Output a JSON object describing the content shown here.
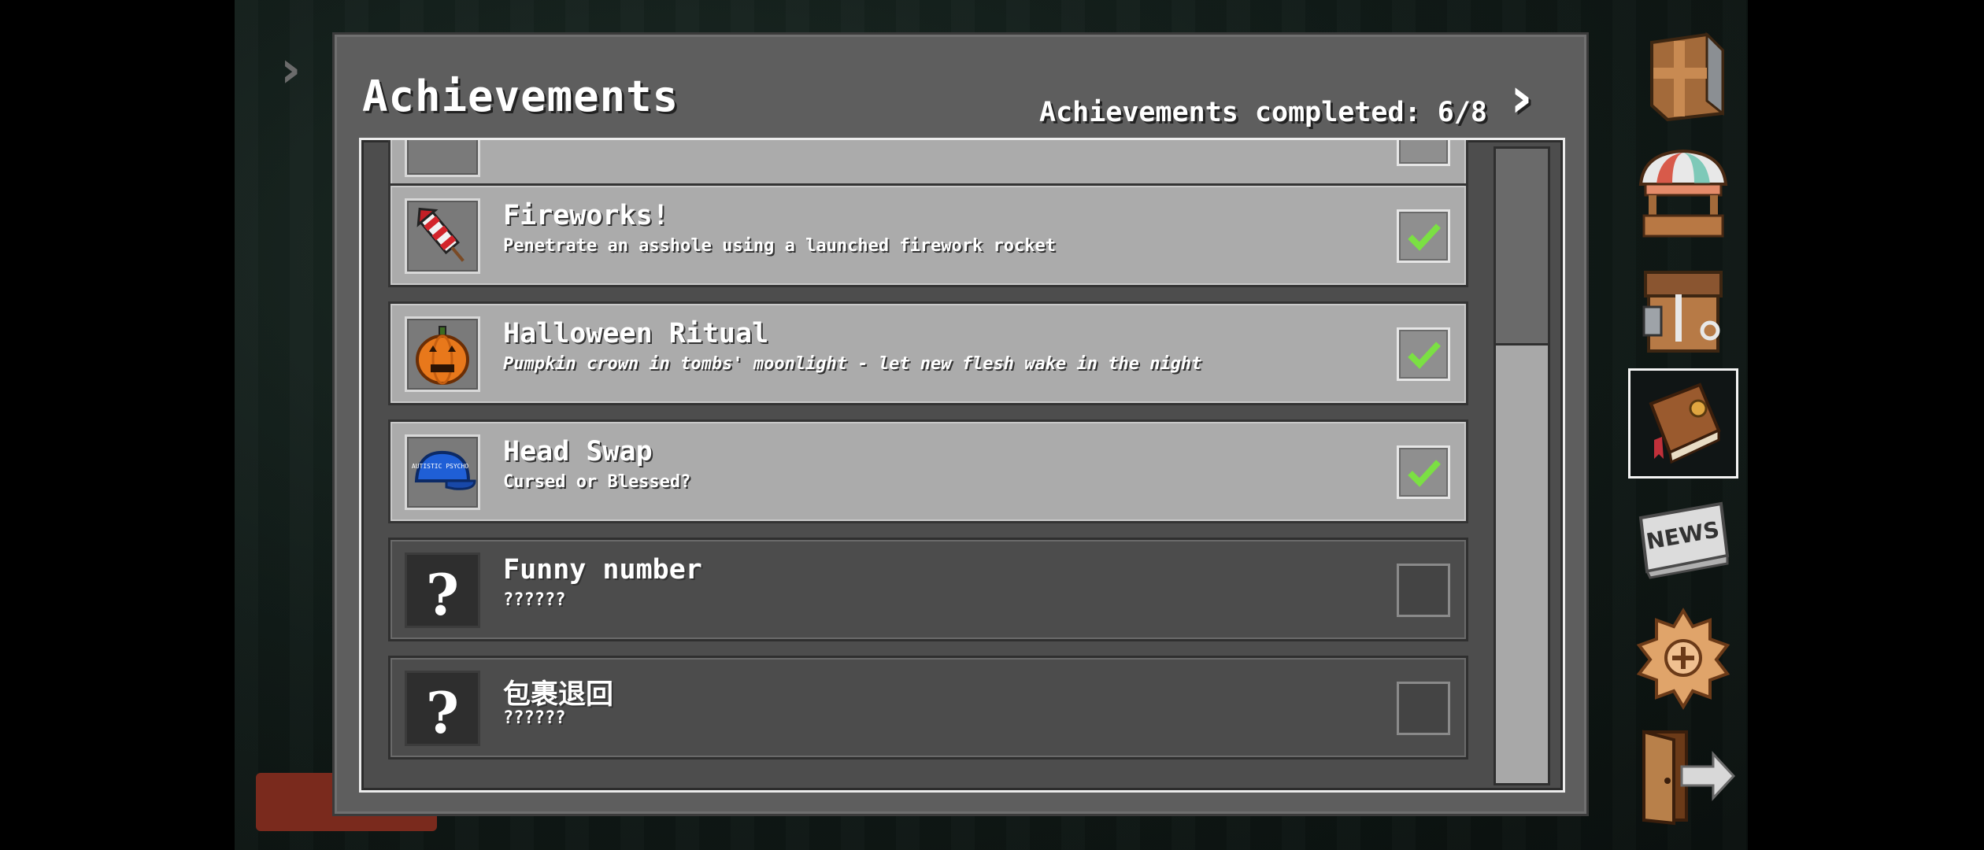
{
  "panel": {
    "title": "Achievements",
    "counter": "Achievements completed: 6/8"
  },
  "achievements": [
    {
      "title": "Fireworks!",
      "desc": "Penetrate an asshole using a launched firework rocket",
      "icon": "firework-rocket-icon",
      "completed": true
    },
    {
      "title": "Halloween Ritual",
      "desc": "Pumpkin crown in tombs' moonlight - let new flesh wake in the night",
      "icon": "pumpkin-icon",
      "completed": true
    },
    {
      "title": "Head Swap",
      "desc": "Cursed or Blessed?",
      "icon": "blue-cap-icon",
      "cap_text": "AUTISTIC PSYCHO",
      "completed": true
    },
    {
      "title": "Funny number",
      "desc": "??????",
      "icon": "question-mark-icon",
      "icon_glyph": "?",
      "completed": false
    },
    {
      "title": "包裹退回",
      "desc": "??????",
      "icon": "question-mark-icon",
      "icon_glyph": "?",
      "completed": false
    }
  ],
  "sidebar": {
    "items": [
      {
        "name": "crate-icon"
      },
      {
        "name": "market-stall-icon"
      },
      {
        "name": "workbench-icon"
      },
      {
        "name": "achievements-book-icon",
        "selected": true
      },
      {
        "name": "news-icon",
        "label": "NEWS"
      },
      {
        "name": "settings-gear-icon"
      },
      {
        "name": "exit-door-icon"
      }
    ]
  },
  "colors": {
    "panel": "#5e5e5e",
    "completed_row": "#ababab",
    "locked_row": "#4c4c4c",
    "check": "#7be043"
  }
}
